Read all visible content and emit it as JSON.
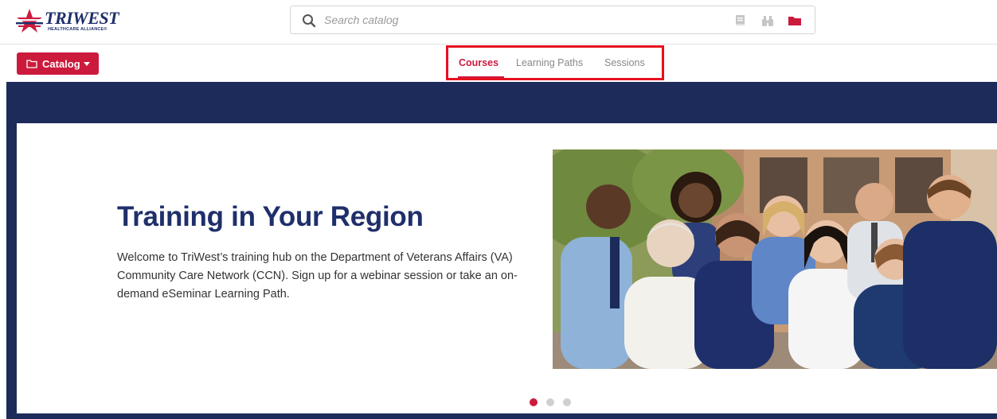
{
  "brand": {
    "logo_word": "TRIWEST",
    "logo_tagline": "HEALTHCARE ALLIANCE®"
  },
  "search": {
    "placeholder": "Search catalog",
    "value": ""
  },
  "toolbar_icons": [
    "book-icon",
    "binoculars-icon",
    "folder-icon"
  ],
  "catalog_button": {
    "label": "Catalog",
    "icon": "folder-outline-icon"
  },
  "tabs": [
    {
      "label": "Courses",
      "active": true
    },
    {
      "label": "Learning Paths",
      "active": false
    },
    {
      "label": "Sessions",
      "active": false
    }
  ],
  "hero": {
    "title": "Training in Your Region",
    "body": "Welcome to TriWest’s training hub on the Department of Veterans Affairs (VA) Community Care Network (CCN). Sign up for a webinar session or take an on-demand eSeminar Learning Path."
  },
  "carousel": {
    "slide_count": 3,
    "active_index": 0
  },
  "colors": {
    "brand_red": "#cc1a3d",
    "brand_navy": "#1f2f6b",
    "band_navy": "#1c2b5a",
    "highlight_red": "#e8101f"
  }
}
